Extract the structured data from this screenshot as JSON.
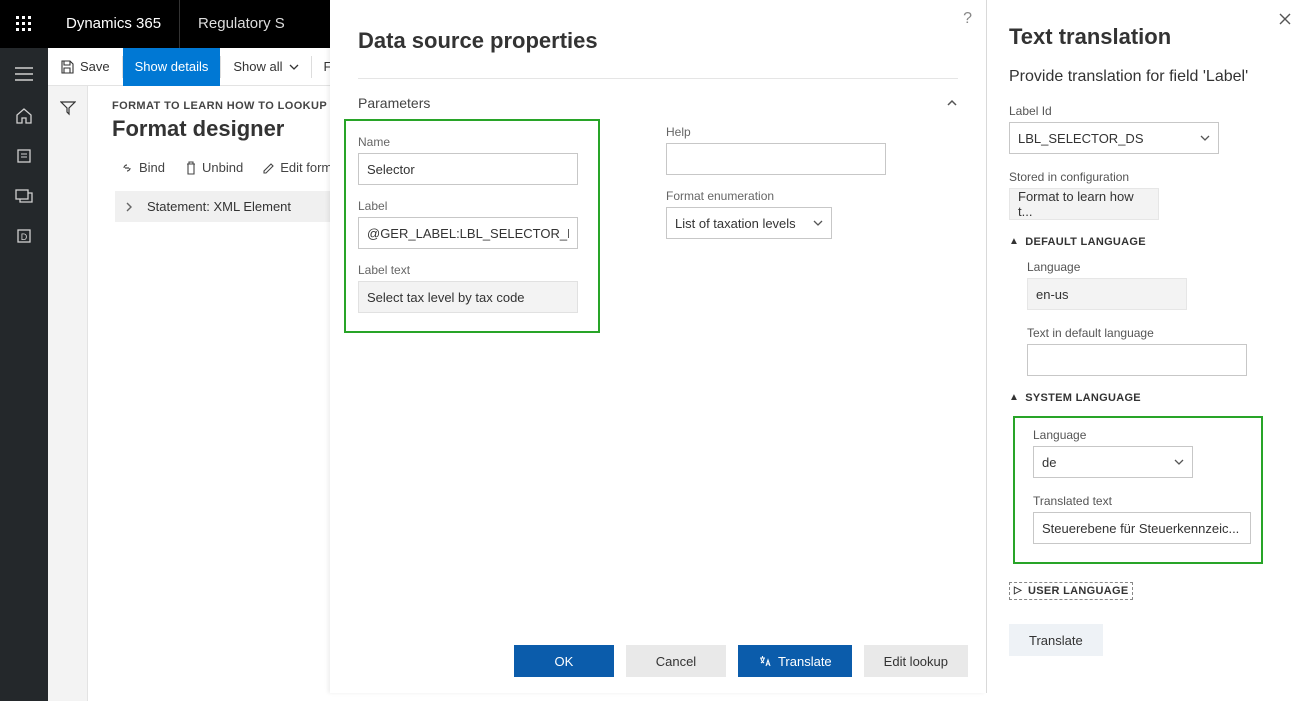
{
  "topbar": {
    "product": "Dynamics 365",
    "module": "Regulatory S"
  },
  "actionbar": {
    "save": "Save",
    "show_details": "Show details",
    "show_all": "Show all",
    "more": "Fo"
  },
  "page": {
    "breadcrumb": "FORMAT TO LEARN HOW TO LOOKUP LE D",
    "title": "Format designer",
    "toolbar": {
      "bind": "Bind",
      "unbind": "Unbind",
      "edit_formula": "Edit form"
    },
    "tree_item": "Statement: XML Element"
  },
  "modal": {
    "title": "Data source properties",
    "section": "Parameters",
    "fields": {
      "name_label": "Name",
      "name_value": "Selector",
      "label_label": "Label",
      "label_value": "@GER_LABEL:LBL_SELECTOR_DS",
      "label_text_label": "Label text",
      "label_text_value": "Select tax level by tax code",
      "help_label": "Help",
      "help_value": "",
      "enum_label": "Format enumeration",
      "enum_value": "List of taxation levels"
    },
    "buttons": {
      "ok": "OK",
      "cancel": "Cancel",
      "translate": "Translate",
      "edit_lookup": "Edit lookup"
    }
  },
  "rpanel": {
    "title": "Text translation",
    "subtitle": "Provide translation for field 'Label'",
    "label_id_label": "Label Id",
    "label_id_value": "LBL_SELECTOR_DS",
    "stored_label": "Stored in configuration",
    "stored_value": "Format to learn how t...",
    "default_group": "DEFAULT LANGUAGE",
    "default_lang_label": "Language",
    "default_lang_value": "en-us",
    "default_text_label": "Text in default language",
    "default_text_value": "",
    "system_group": "SYSTEM LANGUAGE",
    "system_lang_label": "Language",
    "system_lang_value": "de",
    "translated_label": "Translated text",
    "translated_value": "Steuerebene für Steuerkennzeic...",
    "user_group": "USER LANGUAGE",
    "translate_btn": "Translate"
  }
}
